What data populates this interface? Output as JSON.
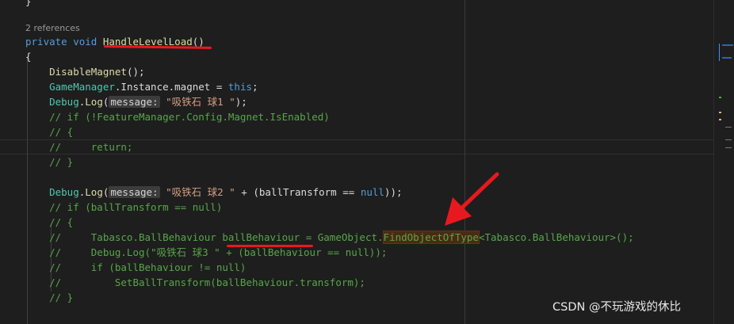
{
  "editor": {
    "top_brace": "}",
    "references": "2 references",
    "lines": [
      {
        "parts": [
          {
            "c": "kw",
            "t": "private"
          },
          {
            "c": "",
            "t": " "
          },
          {
            "c": "kw",
            "t": "void"
          },
          {
            "c": "",
            "t": " "
          },
          {
            "c": "fn",
            "t": "HandleLevelLoad"
          },
          {
            "c": "id",
            "t": "()"
          }
        ]
      },
      {
        "parts": [
          {
            "c": "id",
            "t": "{"
          }
        ]
      },
      {
        "parts": [
          {
            "c": "fn",
            "t": "    DisableMagnet"
          },
          {
            "c": "id",
            "t": "();"
          }
        ]
      },
      {
        "parts": [
          {
            "c": "ty",
            "t": "    GameManager"
          },
          {
            "c": "id",
            "t": ".Instance.magnet = "
          },
          {
            "c": "kw",
            "t": "this"
          },
          {
            "c": "id",
            "t": ";"
          }
        ]
      },
      {
        "parts": [
          {
            "c": "ty",
            "t": "    Debug"
          },
          {
            "c": "id",
            "t": "."
          },
          {
            "c": "fn",
            "t": "Log"
          },
          {
            "c": "id",
            "t": "("
          },
          {
            "c": "hint",
            "t": "message:"
          },
          {
            "c": "",
            "t": " "
          },
          {
            "c": "st",
            "t": "\"吸铁石 球1 \""
          },
          {
            "c": "id",
            "t": ");"
          }
        ]
      },
      {
        "parts": [
          {
            "c": "cm",
            "t": "    // if (!FeatureManager.Config.Magnet.IsEnabled)"
          }
        ]
      },
      {
        "parts": [
          {
            "c": "cm",
            "t": "    // {"
          }
        ]
      },
      {
        "parts": [
          {
            "c": "cm",
            "t": "    //     return;"
          }
        ]
      },
      {
        "parts": [
          {
            "c": "cm",
            "t": "    // }"
          }
        ]
      },
      {
        "parts": []
      },
      {
        "parts": [
          {
            "c": "ty",
            "t": "    Debug"
          },
          {
            "c": "id",
            "t": "."
          },
          {
            "c": "fn",
            "t": "Log"
          },
          {
            "c": "id",
            "t": "("
          },
          {
            "c": "hint",
            "t": "message:"
          },
          {
            "c": "",
            "t": " "
          },
          {
            "c": "st",
            "t": "\"吸铁石 球2 \""
          },
          {
            "c": "id",
            "t": " + (ballTransform == "
          },
          {
            "c": "kw",
            "t": "null"
          },
          {
            "c": "id",
            "t": "));"
          }
        ]
      },
      {
        "parts": [
          {
            "c": "cm",
            "t": "    // if (ballTransform == null)"
          }
        ]
      },
      {
        "parts": [
          {
            "c": "cm",
            "t": "    // {"
          }
        ]
      },
      {
        "parts": [
          {
            "c": "cm",
            "t": "    //     Tabasco.BallBehaviour ballBehaviour = GameObject."
          },
          {
            "c": "cm hl-red",
            "t": "FindObjectOfType"
          },
          {
            "c": "cm",
            "t": "<Tabasco.BallBehaviour>();"
          }
        ]
      },
      {
        "parts": [
          {
            "c": "cm",
            "t": "    //     Debug.Log(\"吸铁石 球3 \" + (ballBehaviour == null));"
          }
        ]
      },
      {
        "parts": [
          {
            "c": "cm",
            "t": "    //     if (ballBehaviour != null)"
          }
        ]
      },
      {
        "parts": [
          {
            "c": "cm",
            "t": "    //         SetBallTransform(ballBehaviour.transform);"
          }
        ]
      },
      {
        "parts": [
          {
            "c": "cm",
            "t": "    // }"
          }
        ]
      }
    ]
  },
  "watermark": "CSDN @不玩游戏的休比",
  "colors": {
    "background": "#1e1e1e",
    "keyword": "#569cd6",
    "method": "#dcdcaa",
    "type": "#4ec9b0",
    "comment": "#57a64a",
    "string": "#d69d85",
    "annotation_red": "#e8191e"
  },
  "icons": [
    "arrow-annotation-icon"
  ]
}
